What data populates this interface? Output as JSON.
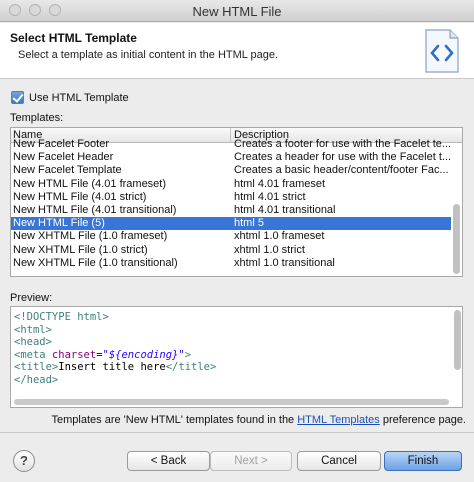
{
  "window": {
    "title": "New HTML File"
  },
  "banner": {
    "title": "Select HTML Template",
    "subtitle": "Select a template as initial content in the HTML page."
  },
  "options": {
    "use_template_label": "Use HTML Template",
    "use_template_checked": true
  },
  "templates": {
    "label": "Templates:",
    "columns": [
      "Name",
      "Description"
    ],
    "rows": [
      {
        "name": "New Facelet Footer",
        "description": "Creates a footer for use with the Facelet te..."
      },
      {
        "name": "New Facelet Header",
        "description": "Creates a header for use with the Facelet t..."
      },
      {
        "name": "New Facelet Template",
        "description": "Creates a basic header/content/footer Fac..."
      },
      {
        "name": "New HTML File (4.01 frameset)",
        "description": "html 4.01 frameset"
      },
      {
        "name": "New HTML File (4.01 strict)",
        "description": "html 4.01 strict"
      },
      {
        "name": "New HTML File (4.01 transitional)",
        "description": "html 4.01 transitional"
      },
      {
        "name": "New HTML File (5)",
        "description": "html 5"
      },
      {
        "name": "New XHTML File (1.0 frameset)",
        "description": "xhtml 1.0 frameset"
      },
      {
        "name": "New XHTML File (1.0 strict)",
        "description": "xhtml 1.0 strict"
      },
      {
        "name": "New XHTML File (1.0 transitional)",
        "description": "xhtml 1.0 transitional"
      }
    ],
    "selected_index": 6
  },
  "preview": {
    "label": "Preview:",
    "doctype": "<!DOCTYPE html>",
    "html_open": "<html>",
    "head_open": "<head>",
    "meta_tag": "<meta",
    "meta_attr": " charset",
    "meta_eq": "=",
    "meta_value": "\"${encoding}\"",
    "meta_close": ">",
    "title_open": "<title>",
    "title_text": "Insert title here",
    "title_close": "</title>",
    "head_close": "</head>"
  },
  "info": {
    "prefix": "Templates are 'New HTML' templates found in the ",
    "link": "HTML Templates",
    "suffix": " preference page."
  },
  "buttons": {
    "help": "?",
    "back": "< Back",
    "next": "Next >",
    "cancel": "Cancel",
    "finish": "Finish"
  }
}
